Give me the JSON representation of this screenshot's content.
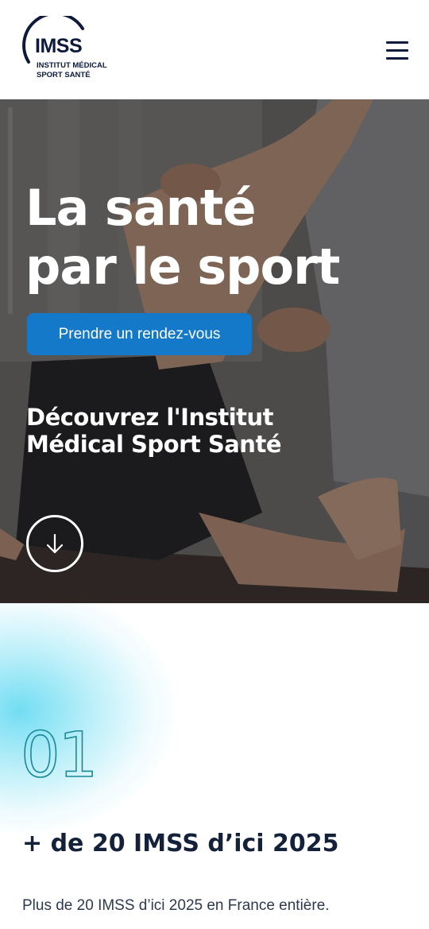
{
  "header": {
    "logo": {
      "main": "IMSS",
      "line1": "INSTITUT MÉDICAL",
      "line2": "SPORT SANTÉ"
    },
    "menu_icon": "hamburger-menu-icon"
  },
  "hero": {
    "title_line1": "La santé",
    "title_line2": "par le sport",
    "cta_label": "Prendre un rendez-vous",
    "subtitle_line1": "Découvrez l'Institut",
    "subtitle_line2": "Médical Sport Santé",
    "scroll_icon": "arrow-down-icon"
  },
  "stats": {
    "number": "01",
    "heading": "+ de 20 IMSS d’ici 2025",
    "description": "Plus de 20 IMSS d’ici 2025 en France entière."
  },
  "colors": {
    "brand_navy": "#0c1a3c",
    "cta_blue": "#1479c8",
    "accent_teal": "#1a8a96",
    "glow_cyan": "#5ad7f0"
  }
}
